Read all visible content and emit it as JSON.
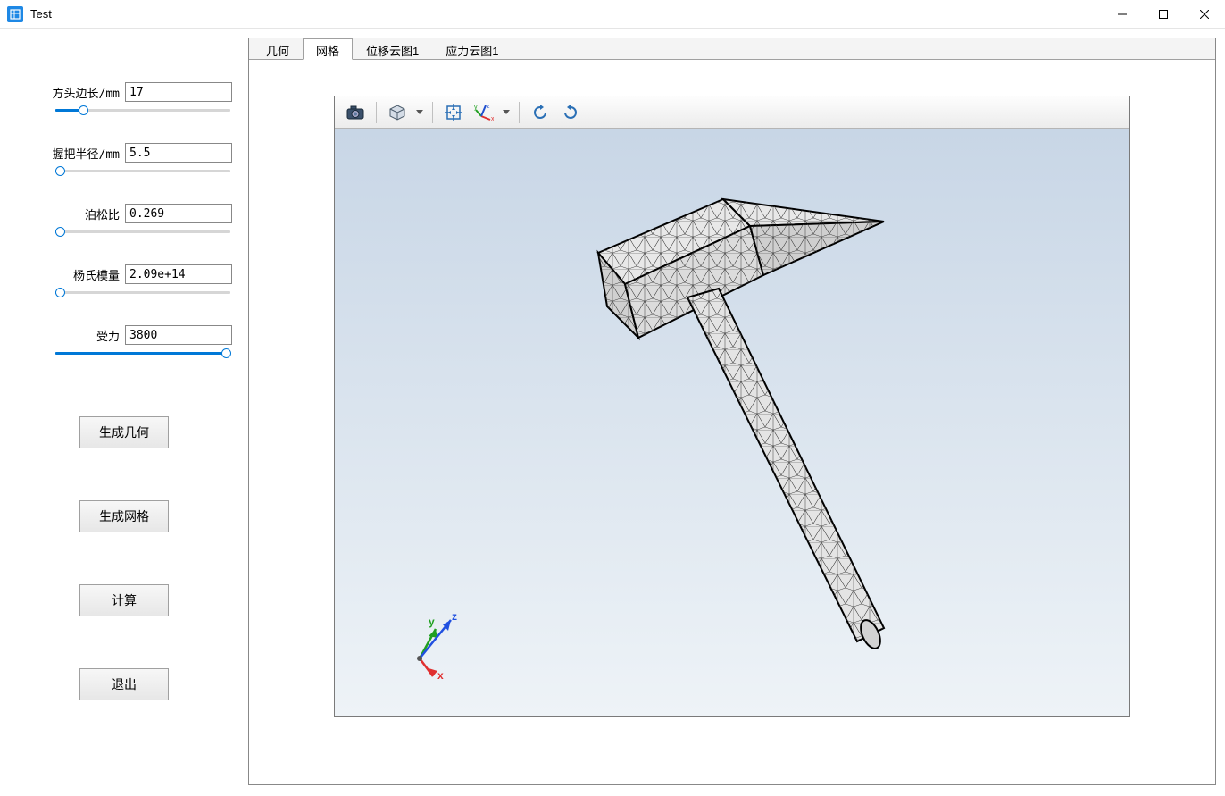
{
  "window": {
    "title": "Test"
  },
  "sidebar": {
    "params": [
      {
        "label": "方头边长/mm",
        "value": "17",
        "slider_pct": 14
      },
      {
        "label": "握把半径/mm",
        "value": "5.5",
        "slider_pct": 2
      },
      {
        "label": "泊松比",
        "value": "0.269",
        "slider_pct": 2
      },
      {
        "label": "杨氏模量",
        "value": "2.09e+14",
        "slider_pct": 2
      },
      {
        "label": "受力",
        "value": "3800",
        "slider_pct": 98
      }
    ],
    "buttons": {
      "gen_geometry": "生成几何",
      "gen_mesh": "生成网格",
      "compute": "计算",
      "exit": "退出"
    }
  },
  "tabs": {
    "items": [
      {
        "key": "geometry",
        "label": "几何"
      },
      {
        "key": "mesh",
        "label": "网格"
      },
      {
        "key": "disp_contour",
        "label": "位移云图1"
      },
      {
        "key": "stress_contour",
        "label": "应力云图1"
      }
    ],
    "active": "mesh"
  },
  "viewport": {
    "toolbar_icons": [
      "camera-icon",
      "sep",
      "view-cube-icon",
      "dropdown",
      "sep",
      "fit-view-icon",
      "axes-icon",
      "dropdown",
      "sep",
      "rotate-ccw-icon",
      "rotate-cw-icon"
    ],
    "axis_labels": {
      "x": "x",
      "y": "y",
      "z": "z"
    }
  }
}
